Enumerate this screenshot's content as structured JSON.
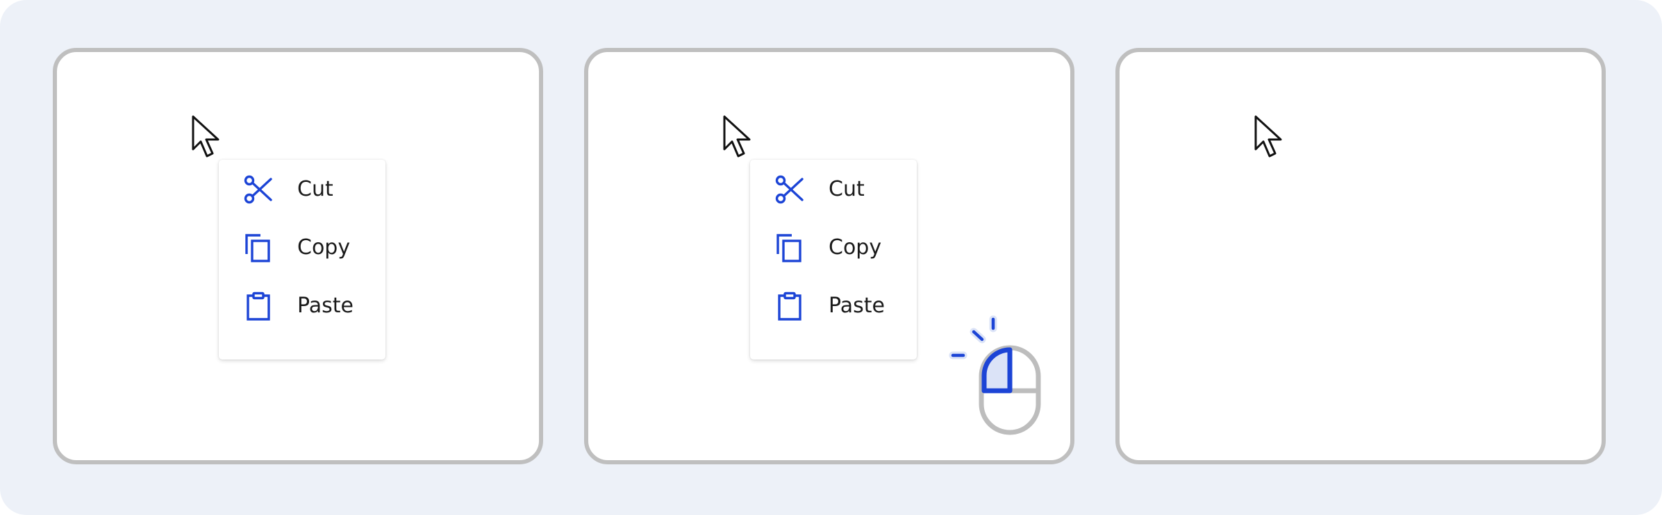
{
  "colors": {
    "background": "#edf1f8",
    "panel_border": "#bfbfbf",
    "accent": "#1c44d6",
    "accent_halo": "#dbe3f7",
    "mouse_outline": "#bdbdbd"
  },
  "icons": {
    "cursor": "arrow-cursor-icon",
    "cut": "scissors-icon",
    "copy": "copy-icon",
    "paste": "clipboard-icon",
    "click": "mouse-left-click-icon"
  },
  "panels": [
    {
      "menu": {
        "items": [
          {
            "label": "Cut"
          },
          {
            "label": "Copy"
          },
          {
            "label": "Paste"
          }
        ]
      }
    },
    {
      "menu": {
        "items": [
          {
            "label": "Cut"
          },
          {
            "label": "Copy"
          },
          {
            "label": "Paste"
          }
        ]
      }
    },
    {}
  ]
}
